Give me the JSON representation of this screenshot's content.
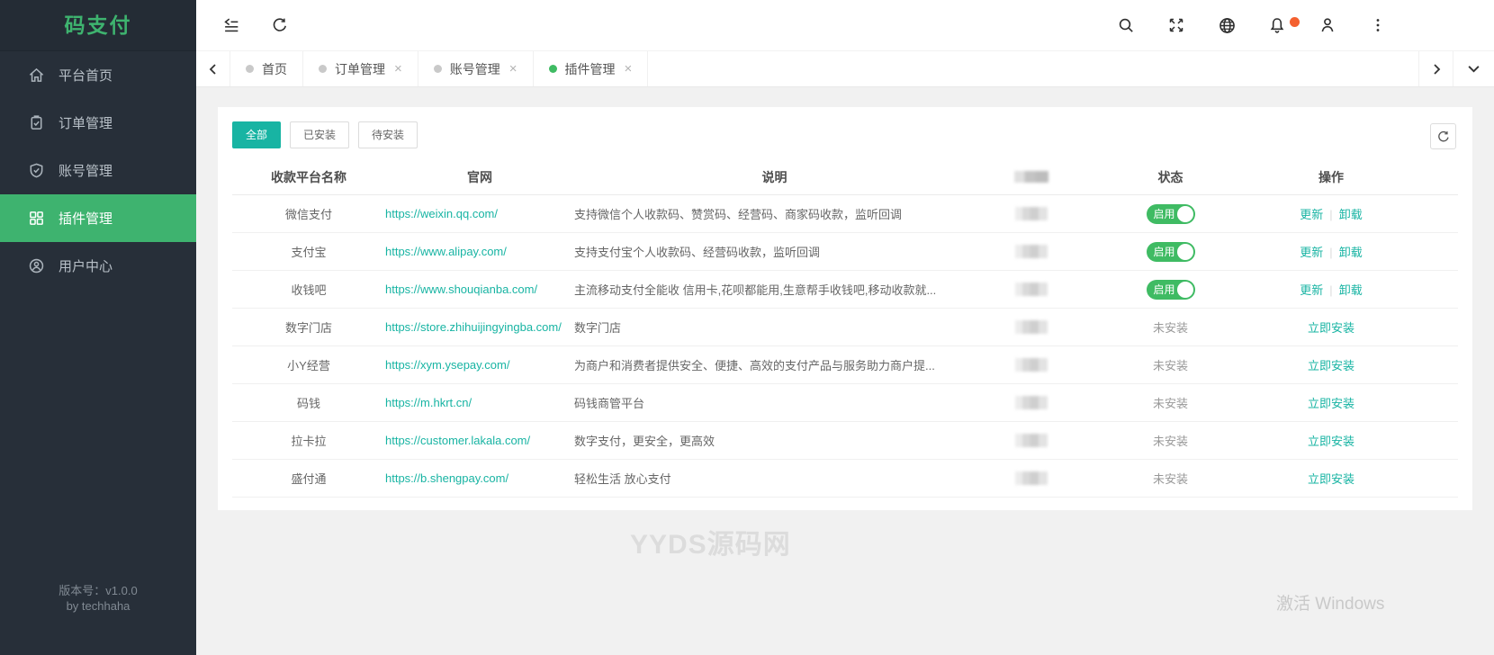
{
  "colors": {
    "green": "#3eb36f",
    "teal": "#18b4a3",
    "toggle_green": "#3fbb63",
    "notification_orange": "#f4602f"
  },
  "brand": {
    "logo": "码支付",
    "version": "版本号：v1.0.0",
    "author": "by techhaha"
  },
  "sidebar": {
    "items": [
      {
        "icon": "home-icon",
        "label": "平台首页",
        "active": false
      },
      {
        "icon": "order-icon",
        "label": "订单管理",
        "active": false
      },
      {
        "icon": "account-icon",
        "label": "账号管理",
        "active": false
      },
      {
        "icon": "plugin-icon",
        "label": "插件管理",
        "active": true
      },
      {
        "icon": "user-center-icon",
        "label": "用户中心",
        "active": false
      }
    ]
  },
  "tabs": {
    "close_glyph": "×",
    "items": [
      {
        "label": "首页",
        "active": false,
        "closable": false
      },
      {
        "label": "订单管理",
        "active": false,
        "closable": true
      },
      {
        "label": "账号管理",
        "active": false,
        "closable": true
      },
      {
        "label": "插件管理",
        "active": true,
        "closable": true
      }
    ]
  },
  "filters": {
    "buttons": [
      {
        "label": "全部",
        "active": true
      },
      {
        "label": "已安装",
        "active": false
      },
      {
        "label": "待安装",
        "active": false
      }
    ]
  },
  "table": {
    "headers": {
      "name": "收款平台名称",
      "site": "官网",
      "desc": "说明",
      "redacted": "",
      "status": "状态",
      "action": "操作"
    },
    "labels": {
      "enabled": "启用",
      "not_installed": "未安装",
      "update": "更新",
      "uninstall": "卸载",
      "install_now": "立即安装",
      "separator": "|"
    },
    "rows": [
      {
        "name": "微信支付",
        "url": "https://weixin.qq.com/",
        "desc": "支持微信个人收款码、赞赏码、经营码、商家码收款，监听回调",
        "installed": true,
        "status": "启用"
      },
      {
        "name": "支付宝",
        "url": "https://www.alipay.com/",
        "desc": "支持支付宝个人收款码、经营码收款，监听回调",
        "installed": true,
        "status": "启用"
      },
      {
        "name": "收钱吧",
        "url": "https://www.shouqianba.com/",
        "desc": "主流移动支付全能收 信用卡,花呗都能用,生意帮手收钱吧,移动收款就...",
        "installed": true,
        "status": "启用"
      },
      {
        "name": "数字门店",
        "url": "https://store.zhihuijingyingba.com/",
        "desc": "数字门店",
        "installed": false,
        "status": "未安装"
      },
      {
        "name": "小Y经营",
        "url": "https://xym.ysepay.com/",
        "desc": "为商户和消费者提供安全、便捷、高效的支付产品与服务助力商户提...",
        "installed": false,
        "status": "未安装"
      },
      {
        "name": "码钱",
        "url": "https://m.hkrt.cn/",
        "desc": "码钱商管平台",
        "installed": false,
        "status": "未安装"
      },
      {
        "name": "拉卡拉",
        "url": "https://customer.lakala.com/",
        "desc": "数字支付，更安全，更高效",
        "installed": false,
        "status": "未安装"
      },
      {
        "name": "盛付通",
        "url": "https://b.shengpay.com/",
        "desc": "轻松生活 放心支付",
        "installed": false,
        "status": "未安装"
      }
    ]
  },
  "watermark": "YYDS源码网",
  "os_watermark": "激活 Windows"
}
